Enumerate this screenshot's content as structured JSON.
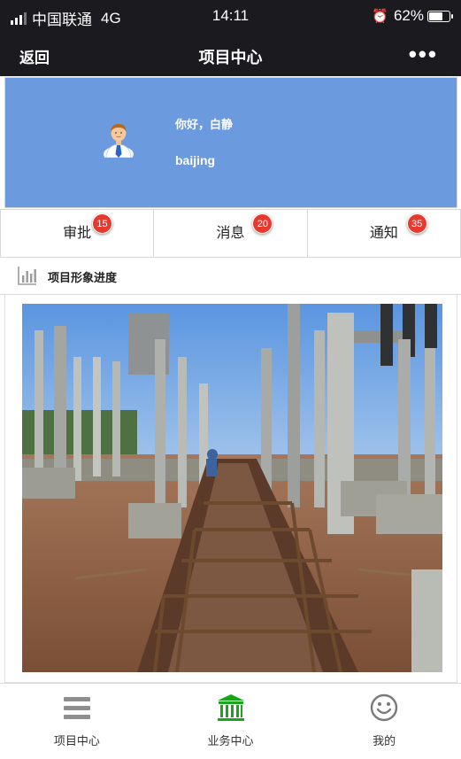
{
  "status_bar": {
    "carrier": "中国联通",
    "network": "4G",
    "time": "14:11",
    "battery_text": "62%",
    "battery_level": 0.62,
    "icons": [
      "signal-icon",
      "alarm-icon",
      "battery-icon"
    ]
  },
  "nav": {
    "back_label": "返回",
    "title": "项目中心",
    "more_label": "•••"
  },
  "profile": {
    "greeting": "你好，白静",
    "username": "baijing",
    "avatar_icon": "avatar-icon",
    "background_color": "#6c9ade"
  },
  "tabs": [
    {
      "label": "审批",
      "badge": "15"
    },
    {
      "label": "消息",
      "badge": "20"
    },
    {
      "label": "通知",
      "badge": "35"
    }
  ],
  "badge_color": "#e8392f",
  "section": {
    "title": "项目形象进度",
    "icon": "bar-chart-icon"
  },
  "bottom_nav": {
    "items": [
      {
        "label": "项目中心",
        "icon": "menu-icon",
        "active": false
      },
      {
        "label": "业务中心",
        "icon": "bank-icon",
        "active": true
      },
      {
        "label": "我的",
        "icon": "smiley-icon",
        "active": false
      }
    ],
    "active_color": "#1aa41a"
  }
}
